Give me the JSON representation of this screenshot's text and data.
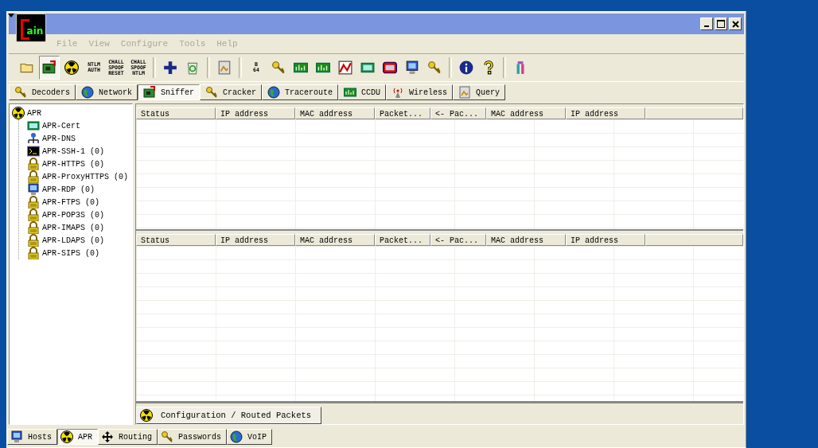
{
  "window": {
    "logo_text": "ain"
  },
  "menu": [
    {
      "label": "File",
      "disabled": true
    },
    {
      "label": "View",
      "disabled": true
    },
    {
      "label": "Configure",
      "disabled": true
    },
    {
      "label": "Tools",
      "disabled": true
    },
    {
      "label": "Help",
      "disabled": true
    }
  ],
  "toolbar": [
    {
      "kind": "folder",
      "pressed": false
    },
    {
      "kind": "board",
      "pressed": true
    },
    {
      "kind": "radiation",
      "pressed": false
    },
    {
      "kind": "text",
      "lines": [
        "NTLM",
        "AUTH"
      ],
      "pressed": false
    },
    {
      "kind": "text",
      "lines": [
        "CHALL",
        "SPOOF",
        "RESET"
      ],
      "pressed": false
    },
    {
      "kind": "text",
      "lines": [
        "CHALL",
        "SPOOF",
        "NTLM"
      ],
      "pressed": false
    },
    {
      "kind": "separator"
    },
    {
      "kind": "plus",
      "pressed": false
    },
    {
      "kind": "recycle",
      "pressed": false
    },
    {
      "kind": "separator"
    },
    {
      "kind": "picture",
      "pressed": false
    },
    {
      "kind": "separator"
    },
    {
      "kind": "text",
      "lines": [
        "B",
        "64"
      ],
      "pressed": false
    },
    {
      "kind": "key",
      "pressed": false
    },
    {
      "kind": "meter",
      "pressed": false
    },
    {
      "kind": "meter",
      "pressed": false
    },
    {
      "kind": "chart",
      "pressed": false
    },
    {
      "kind": "card",
      "pressed": false
    },
    {
      "kind": "screen",
      "pressed": false
    },
    {
      "kind": "monitor",
      "pressed": false
    },
    {
      "kind": "key",
      "pressed": false
    },
    {
      "kind": "separator"
    },
    {
      "kind": "info",
      "pressed": false
    },
    {
      "kind": "question",
      "pressed": false
    },
    {
      "kind": "separator"
    },
    {
      "kind": "tower",
      "pressed": false
    }
  ],
  "tabs": [
    {
      "label": "Decoders",
      "kind": "key",
      "selected": false
    },
    {
      "label": "Network",
      "kind": "globe",
      "selected": false
    },
    {
      "label": "Sniffer",
      "kind": "board",
      "selected": true
    },
    {
      "label": "Cracker",
      "kind": "key",
      "selected": false
    },
    {
      "label": "Traceroute",
      "kind": "globe",
      "selected": false
    },
    {
      "label": "CCDU",
      "kind": "meter",
      "selected": false
    },
    {
      "label": "Wireless",
      "kind": "antenna",
      "selected": false
    },
    {
      "label": "Query",
      "kind": "picture",
      "selected": false
    }
  ],
  "tree": {
    "label": "APR",
    "kind": "radiation",
    "children": [
      {
        "label": "APR-Cert",
        "kind": "card"
      },
      {
        "label": "APR-DNS",
        "kind": "network"
      },
      {
        "label": "APR-SSH-1  (0)",
        "kind": "terminal"
      },
      {
        "label": "APR-HTTPS  (0)",
        "kind": "lock"
      },
      {
        "label": "APR-ProxyHTTPS  (0)",
        "kind": "lock"
      },
      {
        "label": "APR-RDP  (0)",
        "kind": "monitor"
      },
      {
        "label": "APR-FTPS  (0)",
        "kind": "lock"
      },
      {
        "label": "APR-POP3S  (0)",
        "kind": "lock"
      },
      {
        "label": "APR-IMAPS  (0)",
        "kind": "lock"
      },
      {
        "label": "APR-LDAPS  (0)",
        "kind": "lock"
      },
      {
        "label": "APR-SIPS  (0)",
        "kind": "lock"
      }
    ]
  },
  "grids": [
    {
      "columns": [
        "Status",
        "IP address",
        "MAC address",
        "Packet...",
        "<- Pac...",
        "MAC address",
        "IP address"
      ]
    },
    {
      "columns": [
        "Status",
        "IP address",
        "MAC address",
        "Packet...",
        "<- Pac...",
        "MAC address",
        "IP address"
      ]
    }
  ],
  "inner_tabs": [
    {
      "label": "Configuration / Routed Packets",
      "kind": "radiation",
      "selected": true
    }
  ],
  "bottom_tabs": [
    {
      "label": "Hosts",
      "kind": "monitor",
      "selected": false
    },
    {
      "label": "APR",
      "kind": "radiation",
      "selected": true
    },
    {
      "label": "Routing",
      "kind": "arrows",
      "selected": false
    },
    {
      "label": "Passwords",
      "kind": "key",
      "selected": false
    },
    {
      "label": "VoIP",
      "kind": "globe",
      "selected": false
    }
  ]
}
